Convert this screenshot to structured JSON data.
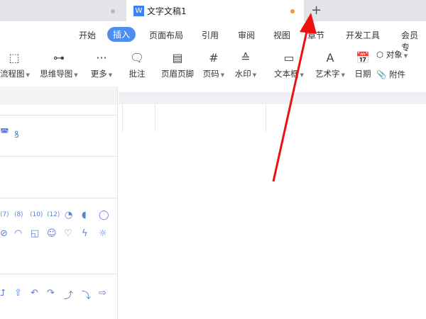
{
  "tabs": {
    "active_title": "文字文稿1",
    "app_icon": "W",
    "new_tab": "+"
  },
  "menu": [
    "开始",
    "插入",
    "页面布局",
    "引用",
    "审阅",
    "视图",
    "章节",
    "开发工具",
    "会员专"
  ],
  "menu_active": "插入",
  "tools": [
    {
      "label": "流程图",
      "caret": true,
      "icon": "flowchart-icon"
    },
    {
      "label": "思维导图",
      "caret": true,
      "icon": "mindmap-icon"
    },
    {
      "label": "更多",
      "caret": true,
      "icon": "more-icon"
    },
    {
      "label": "批注",
      "caret": false,
      "icon": "comment-icon"
    },
    {
      "label": "页眉页脚",
      "caret": false,
      "icon": "header-footer-icon"
    },
    {
      "label": "页码",
      "caret": true,
      "icon": "page-number-icon"
    },
    {
      "label": "水印",
      "caret": true,
      "icon": "watermark-icon"
    },
    {
      "label": "文本框",
      "caret": true,
      "icon": "textbox-icon"
    },
    {
      "label": "艺术字",
      "caret": true,
      "icon": "wordart-icon"
    },
    {
      "label": "日期",
      "caret": false,
      "icon": "date-icon"
    },
    {
      "label": "对象",
      "caret": true,
      "icon": "object-icon"
    },
    {
      "label": "附件",
      "caret": false,
      "icon": "attachment-icon"
    }
  ],
  "shapes": {
    "row_numbers": [
      "7",
      "8",
      "10",
      "12"
    ]
  },
  "colors": {
    "accent": "#4e8ef0",
    "arrow": "#ee1111",
    "shape": "#5b7fd6"
  }
}
